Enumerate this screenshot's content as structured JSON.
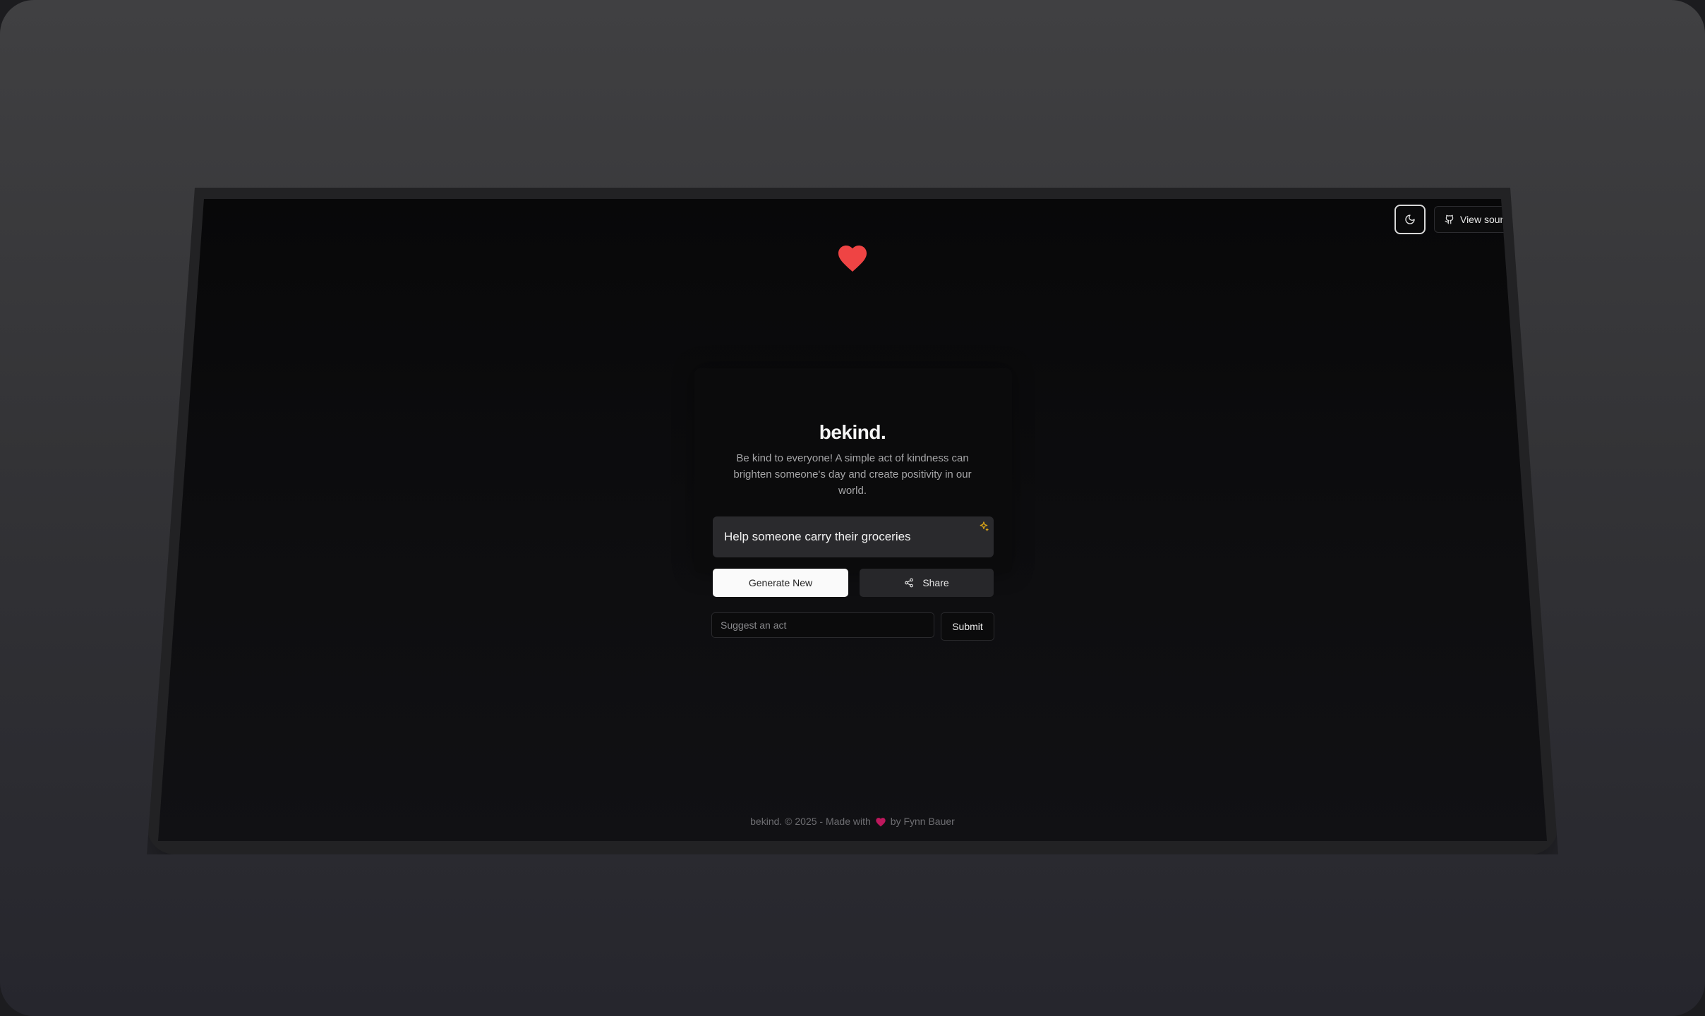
{
  "header": {
    "theme_toggle_icon": "moon-icon",
    "view_source_icon": "github-icon",
    "view_source_label": "View source"
  },
  "hero": {
    "logo_icon": "heart-icon",
    "title": "bekind.",
    "subtitle": "Be kind to everyone! A simple act of kindness can brighten someone's day and create positivity in our world."
  },
  "act": {
    "text": "Help someone carry their groceries",
    "icon": "sparkle-icon"
  },
  "actions": {
    "generate_label": "Generate New",
    "share_label": "Share",
    "share_icon": "share-icon"
  },
  "suggest": {
    "placeholder": "Suggest an act",
    "submit_label": "Submit"
  },
  "footer": {
    "prefix": "bekind. © 2025 - Made with",
    "heart_icon": "heart-icon",
    "suffix": "by Fynn Bauer"
  },
  "colors": {
    "heart": "#ef4444",
    "footer_heart": "#be185d",
    "sparkle": "#d4a017"
  }
}
